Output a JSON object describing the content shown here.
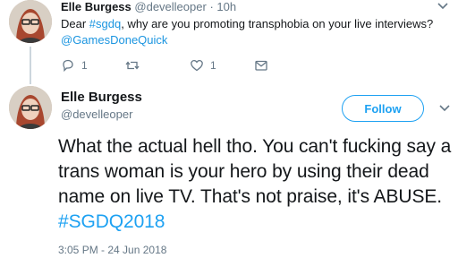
{
  "parent_tweet": {
    "name": "Elle Burgess",
    "handle": "@develleoper",
    "dot": "·",
    "time": "10h",
    "text_prefix": "Dear ",
    "hashtag": "#sgdq",
    "text_middle": ", why are you promoting transphobia on your live interviews?",
    "mention": "@GamesDoneQuick",
    "reply_count": "1",
    "retweet_count": "",
    "like_count": "1"
  },
  "main_tweet": {
    "name": "Elle Burgess",
    "handle": "@develleoper",
    "follow_label": "Follow",
    "text": "What the actual hell tho. You can't fucking say a trans woman is your hero by using their dead name on live TV. That's not praise, it's ABUSE. ",
    "hashtag": "#SGDQ2018",
    "timestamp": "3:05 PM - 24 Jun 2018"
  },
  "colors": {
    "link": "#1b95e0",
    "accent": "#1da1f2",
    "muted": "#657786",
    "text": "#14171a"
  },
  "icons": [
    "reply-icon",
    "retweet-icon",
    "like-icon",
    "dm-icon",
    "chevron-down-icon"
  ]
}
